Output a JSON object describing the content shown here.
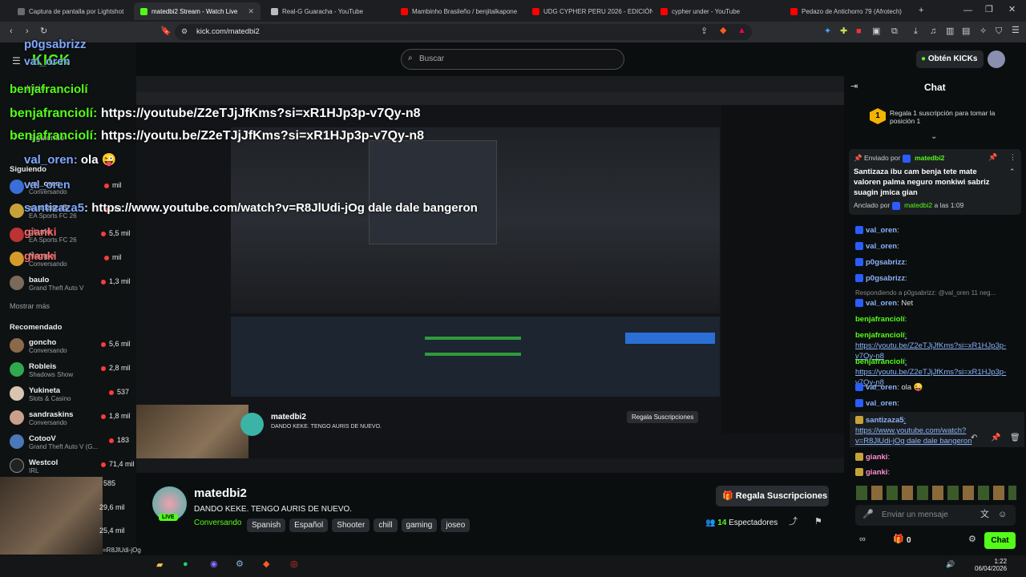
{
  "tabs": [
    {
      "title": "Captura de pantalla por Lightshot",
      "active": false,
      "color": "#6b6b6b"
    },
    {
      "title": "matedbi2 Stream - Watch Live",
      "active": true,
      "color": "#53fc18"
    },
    {
      "title": "Real-G Guaracha - YouTube",
      "active": false,
      "color": "#bbbbbb"
    },
    {
      "title": "Mambinho Brasileño / benjitalkapone",
      "active": false,
      "color": "#ff0000"
    },
    {
      "title": "UDG CYPHER PERU 2026 - EDICIÓN",
      "active": false,
      "color": "#ff0000"
    },
    {
      "title": "cypher under - YouTube",
      "active": false,
      "color": "#ff0000"
    },
    {
      "title": "Pedazo de Antichorro 79 (Afrotech)",
      "active": false,
      "color": "#ff0000"
    }
  ],
  "address": {
    "url": "kick.com/matedbi2"
  },
  "header": {
    "search_placeholder": "Buscar",
    "kicks_button": "Obtén KICKs",
    "logo": "KICK"
  },
  "sidebar": {
    "home": "Inicio",
    "following_label": "Siguiendo",
    "following_item": "Siguiendo",
    "show_more": "Mostrar más",
    "recommended_title": "Recomendado",
    "following": [
      {
        "name": "val_oren",
        "game": "Conversando",
        "viewers": "mil"
      },
      {
        "name": "santizaza5",
        "game": "EA Sports FC 26",
        "viewers": "mil"
      },
      {
        "name": "gianki",
        "game": "EA Sports FC 26",
        "viewers": "5,5 mil"
      },
      {
        "name": "Neggie",
        "game": "Conversando",
        "viewers": "mil"
      },
      {
        "name": "baulo",
        "game": "Grand Theft Auto V",
        "viewers": "1,3 mil"
      }
    ],
    "recommended": [
      {
        "name": "goncho",
        "game": "Conversando",
        "viewers": "5,6 mil"
      },
      {
        "name": "Robleis",
        "game": "Shadows Show",
        "viewers": "2,8 mil"
      },
      {
        "name": "Yukineta",
        "game": "Slots & Casino",
        "viewers": "537"
      },
      {
        "name": "sandraskins",
        "game": "Conversando",
        "viewers": "1,8 mil"
      },
      {
        "name": "CotooV",
        "game": "Grand Theft Auto V (G...",
        "viewers": "183"
      },
      {
        "name": "Westcol",
        "game": "IRL",
        "viewers": "71,4 mil"
      }
    ],
    "extra_counts": [
      "585",
      "29,6 mil",
      "25,4 mil"
    ]
  },
  "overlay_chat": [
    {
      "user": "val_oren",
      "text": ""
    },
    {
      "user": "p0gsabrizz",
      "text": ""
    },
    {
      "user": "p0gsabrizz",
      "text": ""
    },
    {
      "user": "val_oren",
      "text": ""
    },
    {
      "user": "benjafranciolí",
      "text": ""
    },
    {
      "user": "benjafranciolí",
      "text": "https://youtube/Z2eTJjJfKms?si=xR1HJp3p-v7Qy-n8"
    },
    {
      "user": "benjafranciolí",
      "text": "https://youtu.be/Z2eTJjJfKms?si=xR1HJp3p-v7Qy-n8"
    },
    {
      "user": "val_oren",
      "text": "ola"
    },
    {
      "user": "val_oren",
      "text": ""
    },
    {
      "user": "santizaza5",
      "text": "https://www.youtube.com/watch?v=R8JlUdi-jOg dale dale bangeron"
    },
    {
      "user": "gianki",
      "text": ""
    },
    {
      "user": "gianki",
      "text": ""
    }
  ],
  "stream": {
    "channel": "matedbi2",
    "title": "DANDO KEKE. TENGO AURIS DE NUEVO.",
    "category": "Conversando",
    "tags": [
      "Spanish",
      "Español",
      "Shooter",
      "chill",
      "gaming",
      "joseo"
    ],
    "gift_button": "Regala Suscripciones",
    "viewers_count": "14",
    "viewers_label": "Espectadores",
    "live_badge": "LIVE",
    "bottom_link": "=R8JlUdi-jOg"
  },
  "chat": {
    "title": "Chat",
    "gift_promo": "Regala 1 suscripción para tomar la posición 1",
    "gift_rank": "1",
    "pinned": {
      "sent_by_label": "Enviado por",
      "sender": "matedbi2",
      "text": "Santizaza ibu cam benja tete mate valoren palma neguro monkiwi sabriz suagin jmica gian",
      "pinned_by_label": "Anclado por",
      "pinned_by": "matedbi2",
      "time": "a las 1:09"
    },
    "messages": [
      {
        "user": "val_oren",
        "text": ":"
      },
      {
        "user": "val_oren",
        "text": ":"
      },
      {
        "user": "p0gsabrizz",
        "text": ":"
      },
      {
        "user": "p0gsabrizz",
        "text": ":"
      },
      {
        "reply": "Respondiendo a p0gsabrizz: @val_oren 11 neg..."
      },
      {
        "user": "val_oren",
        "text": ": Net"
      },
      {
        "user": "benjafranciolí",
        "text": ":"
      },
      {
        "user": "benjafranciolí",
        "text": ": https://youtu.be/Z2eTJjJfKms?si=xR1HJp3p-v7Qy-n8"
      },
      {
        "user": "benjafranciolí",
        "text": ": https://youtu.be/Z2eTJjJfKms?si=xR1HJp3p-v7Qy-n8"
      },
      {
        "user": "val_oren",
        "text": ": ola"
      },
      {
        "user": "val_oren",
        "text": ":"
      },
      {
        "user": "santizaza5",
        "text": ": https://www.youtube.com/watch?v=R8JlUdi-jOg dale dale bangeron"
      },
      {
        "user": "gianki",
        "text": ":"
      },
      {
        "user": "gianki",
        "text": ":"
      }
    ],
    "input_placeholder": "Enviar un mensaje",
    "send_button": "Chat",
    "points": "0"
  },
  "taskbar": {
    "time": "1:22",
    "date": "06/04/2026"
  },
  "colors": {
    "accent": "#53fc18",
    "bg": "#0b0e0f",
    "link": "#8ab4f8"
  }
}
